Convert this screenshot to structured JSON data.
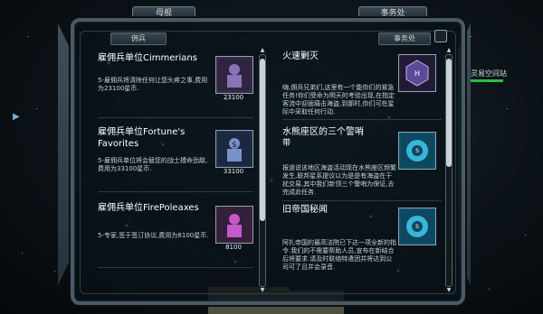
{
  "top_tabs": {
    "left": "母舰",
    "right": "事务处"
  },
  "side": {
    "label": "灵易空间站"
  },
  "left_panel": {
    "header": "佣兵",
    "items": [
      {
        "title": "雇佣兵单位Cimmerians",
        "desc": "5-雇佣兵将清除任何让您头疼之事,费用为23100星币.",
        "price": "23100",
        "icon": "cimmerians-emblem-icon"
      },
      {
        "title": "雇佣兵单位Fortune's Favorites",
        "desc": "5-雇佣兵单位将会替您的战士搏命劲敌,费用为33100星币.",
        "price": "33100",
        "icon": "fortunes-favorites-emblem-icon"
      },
      {
        "title": "雇佣兵单位FirePoleaxes",
        "desc": "5-专家,签于签订协议,费用为8100星币.",
        "price": "8100",
        "icon": "firepoleaxes-emblem-icon"
      }
    ]
  },
  "right_panel": {
    "header": "事务处",
    "items": [
      {
        "title": "火速剿灭",
        "desc": "嗨,佣兵兄弟们,这里有一个能你们的紧急任务!你们受命为明天的考验出现,在指定客流中迎面痛击海盗,到那时,你们可在星际中采取任何行动.",
        "icon": "hex-emblem-icon"
      },
      {
        "title": "水熊座区的三个警哨",
        "subtitle": "带",
        "desc": "报道说该地区海盗活动现在水熊座区频繁发生,联邦星系提议以为是是有海盗在干扰交易,其中我们新领三个警哨为保证,去完成此任务.",
        "icon": "stunbot-emblem-icon"
      },
      {
        "title": "旧帝国秘闻",
        "desc": "阿扎帝国的最高法院已下达一项全新的指令.我们的不需要帮助人员,宣布在新结合后将要求.请及时联络特遣团并将达到公司可了且并会录音.",
        "icon": "stunbot-emblem-icon"
      }
    ]
  },
  "colors": {
    "accent": "#27c23a",
    "frame": "#4a5a66"
  }
}
